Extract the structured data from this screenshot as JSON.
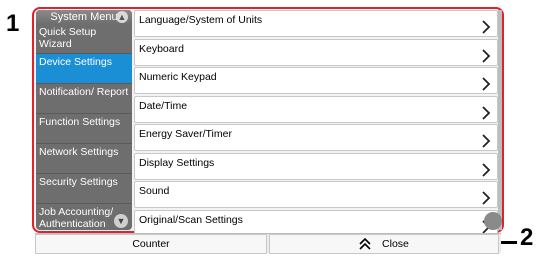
{
  "callouts": {
    "left_number": "1",
    "right_number": "2"
  },
  "sidebar": {
    "header": "System Menu",
    "items": [
      {
        "label": "Quick Setup Wizard"
      },
      {
        "label": "Device Settings"
      },
      {
        "label": "Notification/ Report"
      },
      {
        "label": "Function Settings"
      },
      {
        "label": "Network Settings"
      },
      {
        "label": "Security Settings"
      },
      {
        "label": "Job Accounting/ Authentication"
      }
    ],
    "active_index": 1,
    "accent_color": "#1a8fd6",
    "header_icon": "chevron-up-icon",
    "scroll_icon": "chevron-down-icon"
  },
  "list": {
    "items": [
      {
        "label": "Language/System of Units"
      },
      {
        "label": "Keyboard"
      },
      {
        "label": "Numeric Keypad"
      },
      {
        "label": "Date/Time"
      },
      {
        "label": "Energy Saver/Timer"
      },
      {
        "label": "Display Settings"
      },
      {
        "label": "Sound"
      },
      {
        "label": "Original/Scan Settings"
      }
    ],
    "item_icon": "chevron-right-icon"
  },
  "bottom_bar": {
    "counter_label": "Counter",
    "close_label": "Close",
    "close_icon": "double-chevron-up-icon"
  },
  "highlight_color": "#e0222a"
}
